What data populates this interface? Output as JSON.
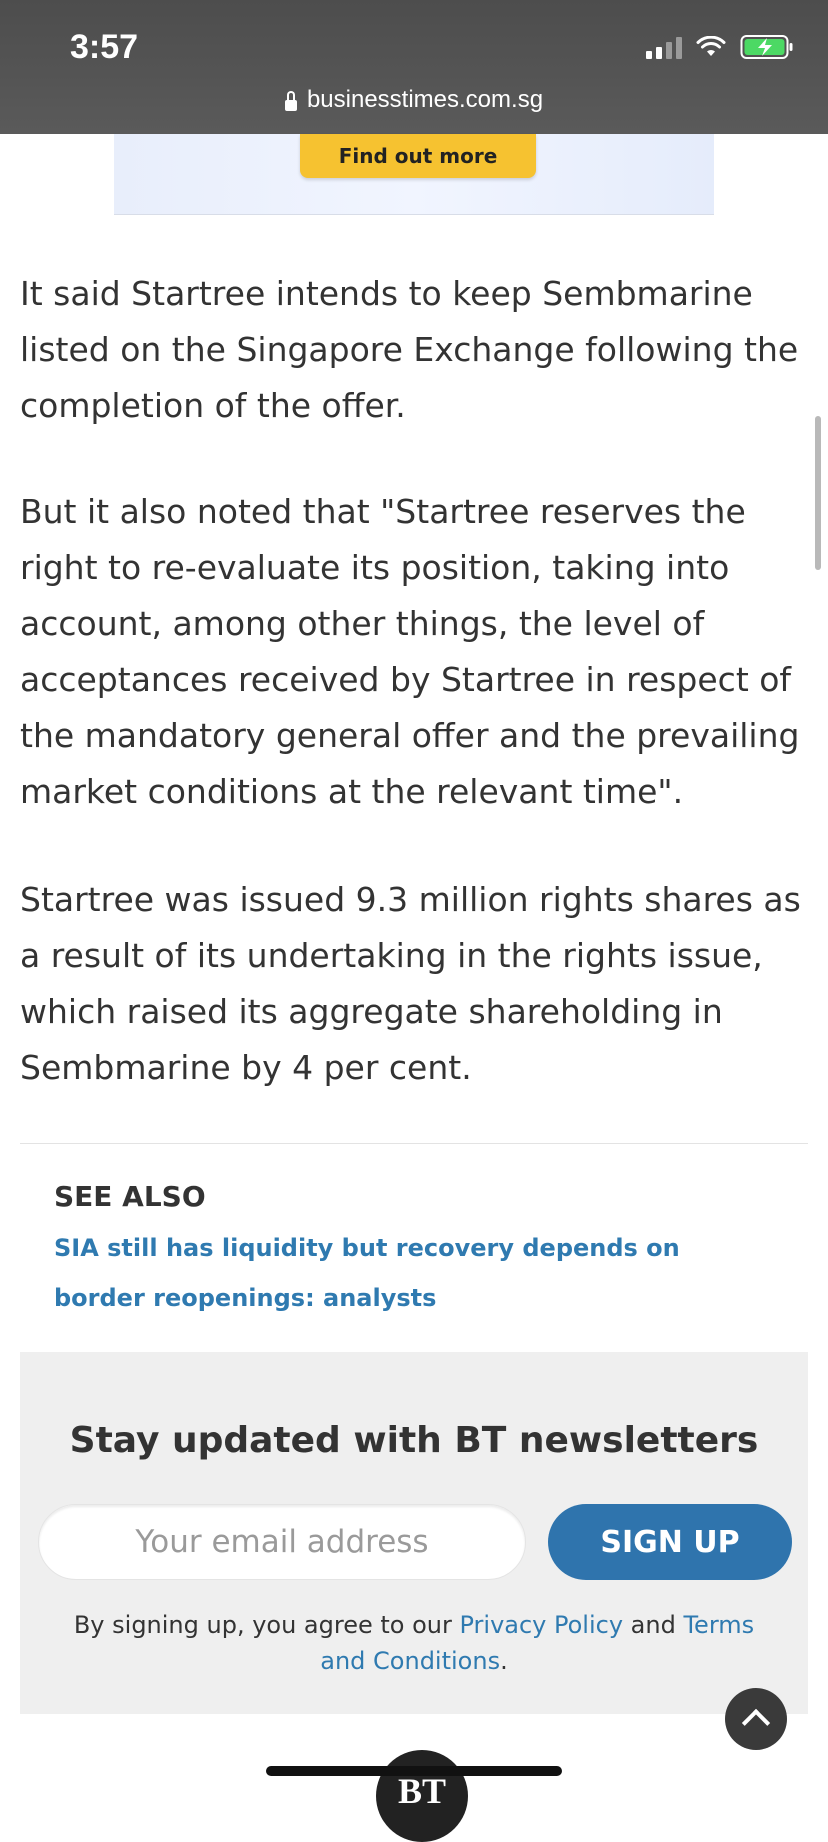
{
  "status_bar": {
    "time": "3:57",
    "url": "businesstimes.com.sg",
    "icons": [
      "signal-icon",
      "wifi-icon",
      "battery-charging-icon"
    ]
  },
  "ad": {
    "button_label": "Find out more"
  },
  "article": {
    "paragraphs": [
      "It said Startree intends to keep Sembmarine listed on the Singapore Exchange following the completion of the offer.",
      "But it also noted that \"Startree reserves the right to re-evaluate its position, taking into account, among other things, the level of acceptances received by Startree in respect of the mandatory general offer and the prevailing market conditions at the relevant time\".",
      "Startree was issued 9.3 million rights shares as a result of its undertaking in the rights issue, which raised its aggregate shareholding in Sembmarine by 4 per cent."
    ]
  },
  "see_also": {
    "heading": "SEE ALSO",
    "link": "SIA still has liquidity but recovery depends on border reopenings: analysts"
  },
  "newsletter": {
    "title": "Stay updated with BT newsletters",
    "email_placeholder": "Your email address",
    "signup_label": "SIGN UP",
    "terms_prefix": "By signing up, you agree to our ",
    "privacy_label": "Privacy Policy",
    "terms_and": " and ",
    "terms_label": "Terms and Conditions",
    "terms_suffix": "."
  },
  "footer": {
    "logo_text": "BT"
  },
  "colors": {
    "link": "#2f7ab0",
    "button": "#2f74ad",
    "ad_button": "#f6c230"
  }
}
